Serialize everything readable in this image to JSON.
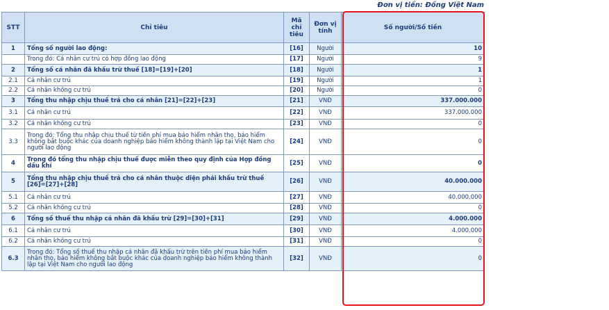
{
  "unit_label": "Đơn vị tiền: Đồng Việt Nam",
  "headers": {
    "stt": "STT",
    "chitieu": "Chỉ tiêu",
    "ma": "Mã chỉ tiêu",
    "dvt": "Đơn vị tính",
    "value": "Số người/Số tiền"
  },
  "rows": [
    {
      "stt": "1",
      "label": "Tổng số người lao động:",
      "code": "[16]",
      "unit": "Người",
      "value": "10",
      "bold": true,
      "hl": true
    },
    {
      "stt": "",
      "label": "Trong đó: Cá nhân cư trú có hợp đồng lao động",
      "code": "[17]",
      "unit": "Người",
      "value": "9",
      "bold": false,
      "hl": false
    },
    {
      "stt": "2",
      "label": "Tổng số cá nhân đã khấu trừ thuế [18]=[19]+[20]",
      "code": "[18]",
      "unit": "Người",
      "value": "1",
      "bold": true,
      "hl": true
    },
    {
      "stt": "2.1",
      "label": "Cá nhân cư trú",
      "code": "[19]",
      "unit": "Người",
      "value": "1",
      "bold": false,
      "hl": false
    },
    {
      "stt": "2.2",
      "label": "Cá nhân không cư trú",
      "code": "[20]",
      "unit": "Người",
      "value": "0",
      "bold": false,
      "hl": false
    },
    {
      "stt": "3",
      "label": "Tổng thu nhập chịu thuế trả cho cá nhân [21]=[22]+[23]",
      "code": "[21]",
      "unit": "VNĐ",
      "value": "337.000.000",
      "bold": true,
      "hl": true
    },
    {
      "stt": "3.1",
      "label": "Cá nhân cư trú",
      "code": "[22]",
      "unit": "VNĐ",
      "value": "337.000.000",
      "bold": false,
      "hl": false
    },
    {
      "stt": "3.2",
      "label": "Cá nhân không cư trú",
      "code": "[23]",
      "unit": "VNĐ",
      "value": "0",
      "bold": false,
      "hl": false
    },
    {
      "stt": "3.3",
      "label": "Trong đó: Tổng thu nhập chịu thuế từ tiền phí mua bảo hiểm nhân thọ, bảo hiểm không bắt buộc khác của doanh nghiệp bảo hiểm không thành lập tại Việt Nam cho người lao động",
      "code": "[24]",
      "unit": "VNĐ",
      "value": "0",
      "bold": false,
      "hl": false
    },
    {
      "stt": "4",
      "label": "Trong đó tổng thu nhập chịu thuế được miễn theo quy định của Hợp đồng dầu khí",
      "code": "[25]",
      "unit": "VNĐ",
      "value": "0",
      "bold": true,
      "hl": false
    },
    {
      "stt": "5",
      "label": "Tổng thu nhập chịu thuế trả cho cá nhân thuộc diện phải khấu trừ thuế [26]=[27]+[28]",
      "code": "[26]",
      "unit": "VNĐ",
      "value": "40.000.000",
      "bold": true,
      "hl": true
    },
    {
      "stt": "5.1",
      "label": "Cá nhân cư trú",
      "code": "[27]",
      "unit": "VNĐ",
      "value": "40.000.000",
      "bold": false,
      "hl": false
    },
    {
      "stt": "5.2",
      "label": "Cá nhân không cư trú",
      "code": "[28]",
      "unit": "VNĐ",
      "value": "0",
      "bold": false,
      "hl": false
    },
    {
      "stt": "6",
      "label": "Tổng số thuế thu nhập cá nhân đã khấu trừ [29]=[30]+[31]",
      "code": "[29]",
      "unit": "VNĐ",
      "value": "4.000.000",
      "bold": true,
      "hl": true
    },
    {
      "stt": "6.1",
      "label": "Cá nhân cư trú",
      "code": "[30]",
      "unit": "VNĐ",
      "value": "4.000.000",
      "bold": false,
      "hl": false
    },
    {
      "stt": "6.2",
      "label": "Cá nhân không cư trú",
      "code": "[31]",
      "unit": "VNĐ",
      "value": "0",
      "bold": false,
      "hl": false
    },
    {
      "stt": "6.3",
      "label": "Trong đó: Tổng số thuế thu nhập cá nhân đã khấu trừ trên tiền phí mua bảo hiểm nhân thọ, bảo hiểm không bắt buộc khác của doanh nghiệp bảo hiểm không thành lập tại Việt Nam cho người lao động",
      "code": "[32]",
      "unit": "VNĐ",
      "value": "0",
      "bold": false,
      "hl": true,
      "stt_bold": true
    }
  ],
  "colors": {
    "text": "#1c3c7c",
    "header_bg": "#cfe0f4",
    "row_highlight": "#e4f0fa",
    "border": "#7f96bf",
    "red_box": "#e8141c"
  }
}
